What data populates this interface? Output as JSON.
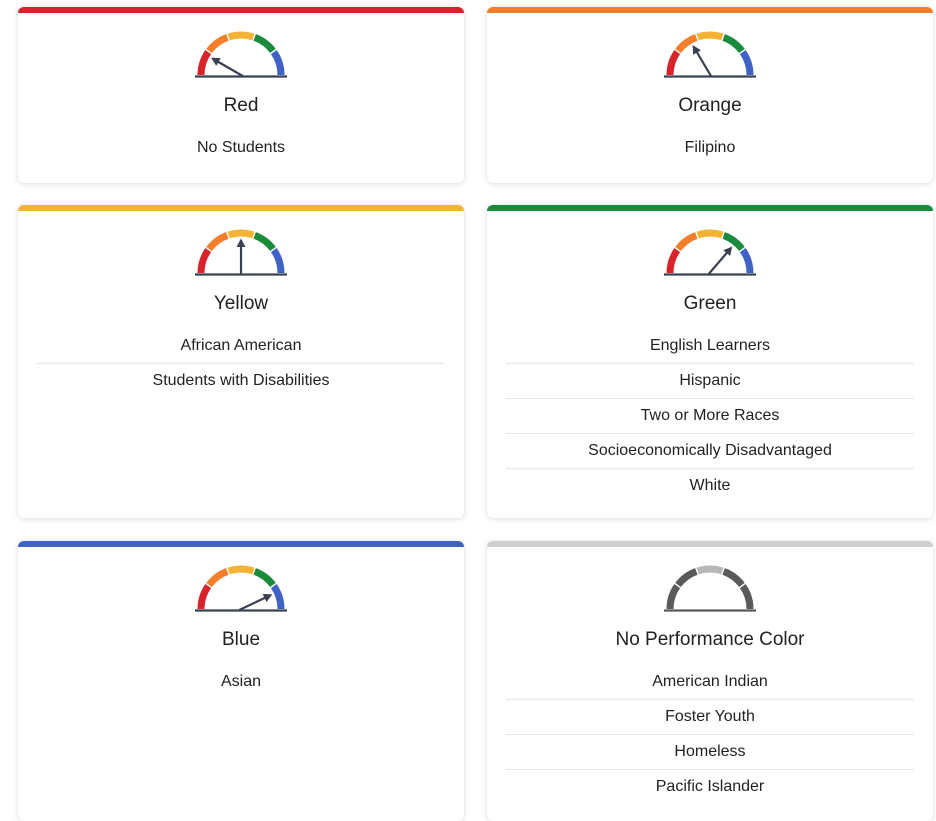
{
  "cards": [
    {
      "level": "Red",
      "accent": "#d8232a",
      "needle": "red",
      "groups": [
        "No Students"
      ]
    },
    {
      "level": "Orange",
      "accent": "#f47e2a",
      "needle": "orange",
      "groups": [
        "Filipino"
      ]
    },
    {
      "level": "Yellow",
      "accent": "#f5b335",
      "needle": "yellow",
      "groups": [
        "African American",
        "Students with Disabilities"
      ]
    },
    {
      "level": "Green",
      "accent": "#1a8a3c",
      "needle": "green",
      "groups": [
        "English Learners",
        "Hispanic",
        "Two or More Races",
        "Socioeconomically Disadvantaged",
        "White"
      ]
    },
    {
      "level": "Blue",
      "accent": "#3f62c6",
      "needle": "blue",
      "groups": [
        "Asian"
      ]
    },
    {
      "level": "No Performance Color",
      "accent": "#d0d0d0",
      "needle": "none",
      "groups": [
        "American Indian",
        "Foster Youth",
        "Homeless",
        "Pacific Islander"
      ]
    }
  ],
  "gauge_colors": {
    "red": "#d8232a",
    "orange": "#f47e2a",
    "yellow": "#f5b335",
    "green": "#1a8a3c",
    "blue": "#3f62c6",
    "needle": "#3a4152",
    "grey_dark": "#5a5a5a",
    "grey_light": "#b8b8b8"
  }
}
